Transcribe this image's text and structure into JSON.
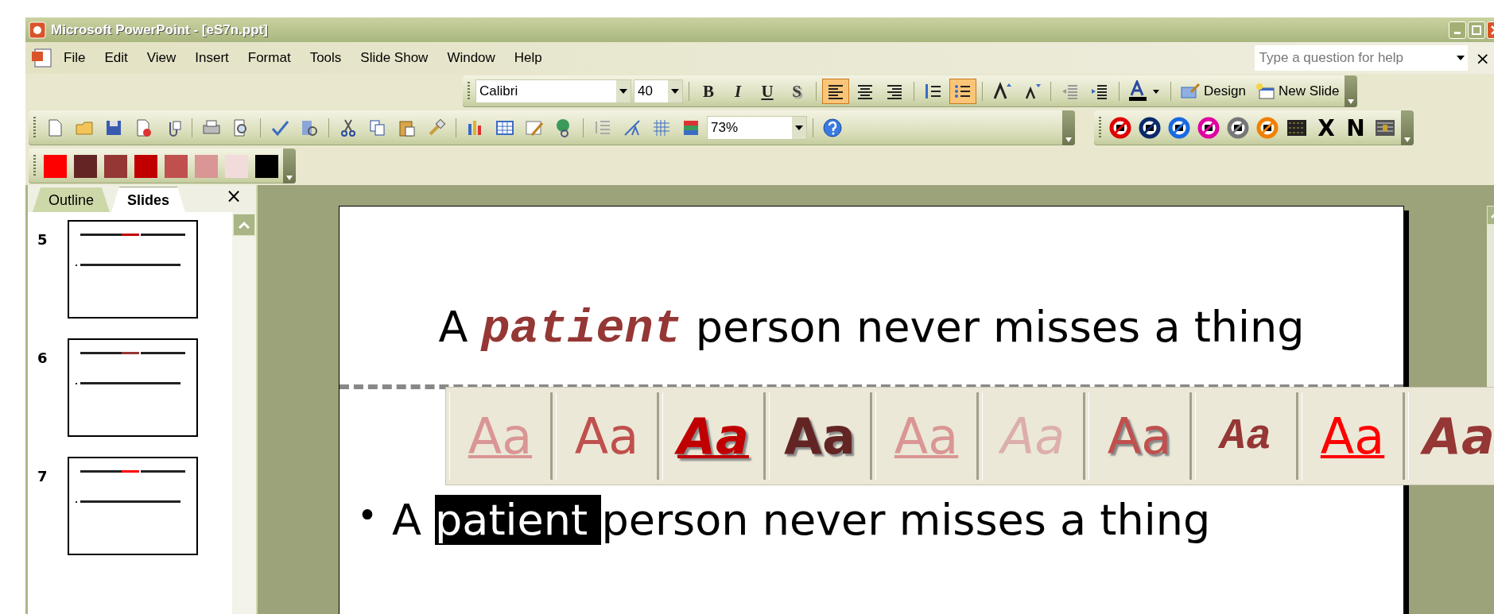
{
  "window": {
    "title": "Microsoft PowerPoint - [eS7n.ppt]"
  },
  "menu": {
    "items": [
      "File",
      "Edit",
      "View",
      "Insert",
      "Format",
      "Tools",
      "Slide Show",
      "Window",
      "Help"
    ],
    "help_field": {
      "placeholder": "Type a question for help"
    },
    "close": "×"
  },
  "formatting_toolbar": {
    "font": "Calibri",
    "size": "40",
    "buttons": [
      {
        "kind": "text",
        "label": "B"
      },
      {
        "kind": "text",
        "label": "I"
      },
      {
        "kind": "text",
        "label": "U"
      },
      {
        "kind": "text",
        "label": "S"
      },
      {
        "kind": "icon",
        "selected": true
      },
      {
        "kind": "icon",
        "selected": false
      },
      {
        "kind": "icon",
        "selected": false
      },
      {
        "kind": "icon",
        "selected": false
      },
      {
        "kind": "icon",
        "selected": true
      },
      {
        "kind": "icon",
        "selected": false
      },
      {
        "kind": "icon",
        "selected": false
      },
      {
        "kind": "icon",
        "selected": false
      },
      {
        "kind": "icon",
        "selected": false
      },
      {
        "kind": "fontcolor"
      },
      {
        "kind": "labeled",
        "label": "Design"
      },
      {
        "kind": "labeled",
        "label": "New Slide"
      }
    ]
  },
  "standard_toolbar": {
    "zoom": "73%"
  },
  "custom_toolbar": {
    "letters": [
      "X",
      "N"
    ]
  },
  "color_toolbar": {
    "colors": [
      {
        "color": "#ff0000"
      },
      {
        "color": "#632523"
      },
      {
        "color": "#953735"
      },
      {
        "color": "#c00000"
      },
      {
        "color": "#c0504d"
      },
      {
        "color": "#d99694"
      },
      {
        "color": "#f2dcdb"
      },
      {
        "color": "#000000"
      }
    ]
  },
  "slides_panel": {
    "tabs": [
      {
        "label": "Outline",
        "selected": false
      },
      {
        "label": "Slides",
        "selected": true
      }
    ],
    "close": "×",
    "thumbnails": [
      {
        "number": "5"
      },
      {
        "number": "6"
      },
      {
        "number": "7"
      }
    ]
  },
  "slide": {
    "title": "A **patient** person never misses a thing",
    "bullet": "•",
    "body": [
      {
        "text": "A ",
        "selected": false
      },
      {
        "text": "patient ",
        "selected": true
      },
      {
        "text": "person never misses a thing",
        "selected": false
      }
    ]
  },
  "style_gallery": [
    {
      "text": "Aa",
      "kind": "underline",
      "color": "#d99694"
    },
    {
      "text": "Aa",
      "kind": "plain",
      "color": "#c0504d"
    },
    {
      "text": "Aa",
      "kind": "bold-italic-shadow-underline",
      "color": "#c00000"
    },
    {
      "text": "Aa",
      "kind": "bold-shadow",
      "color": "#632523"
    },
    {
      "text": "Aa",
      "kind": "underline",
      "color": "#d99694"
    },
    {
      "text": "Aa",
      "kind": "italic",
      "color": "#dcaeac"
    },
    {
      "text": "Aa",
      "kind": "shadow",
      "color": "#c0504d"
    },
    {
      "text": "Aa",
      "kind": "mono-bold",
      "color": "#953735"
    },
    {
      "text": "Aa",
      "kind": "underline",
      "color": "#ff0000"
    },
    {
      "text": "Aa",
      "kind": "bold-italic",
      "color": "#953735"
    }
  ]
}
